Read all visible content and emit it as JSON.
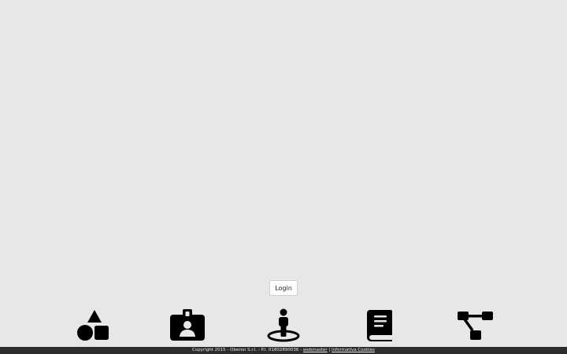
{
  "login": {
    "label": "Login"
  },
  "icons": [
    {
      "name": "shapes-icon"
    },
    {
      "name": "id-badge-icon"
    },
    {
      "name": "person-location-icon"
    },
    {
      "name": "book-icon"
    },
    {
      "name": "sitemap-icon"
    }
  ],
  "footer": {
    "text": "Copyright 2015 - Oberon S.r.l. - P.I. 01802890036 -",
    "webmaster_link": "webmaster",
    "separator": "|",
    "cookies_link": "Informativa Cookies"
  }
}
